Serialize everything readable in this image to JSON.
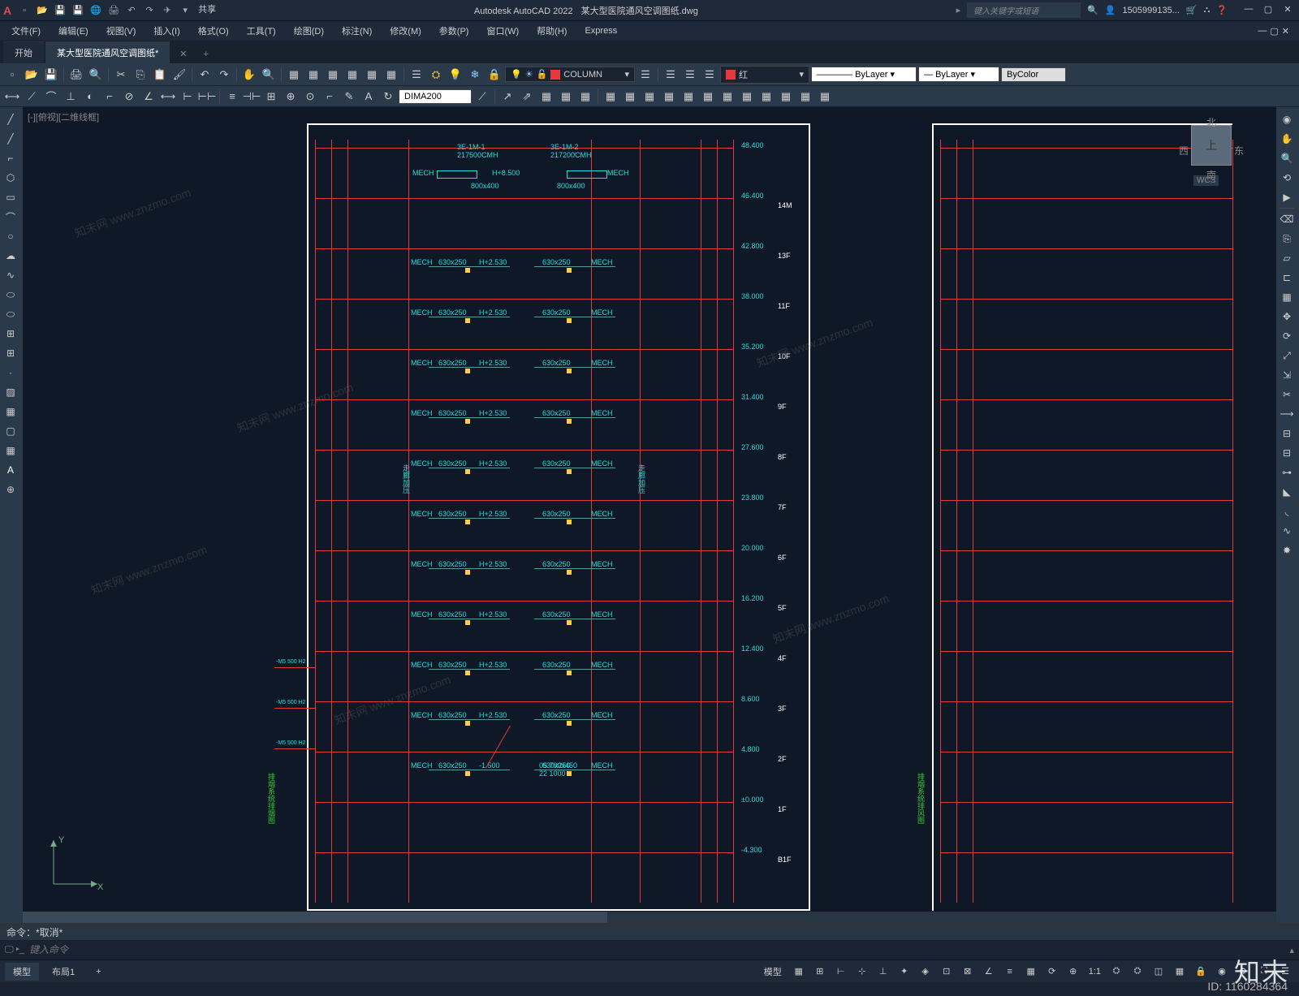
{
  "app": {
    "name": "Autodesk AutoCAD 2022",
    "filename": "某大型医院通风空调图纸.dwg",
    "share": "共享"
  },
  "search_placeholder": "键入关键字或短语",
  "user": "1505999135...",
  "menus": [
    "文件(F)",
    "编辑(E)",
    "视图(V)",
    "插入(I)",
    "格式(O)",
    "工具(T)",
    "绘图(D)",
    "标注(N)",
    "修改(M)",
    "参数(P)",
    "窗口(W)",
    "帮助(H)",
    "Express"
  ],
  "tabs": {
    "start": "开始",
    "doc": "某大型医院通风空调图纸*"
  },
  "layer_current": "COLUMN",
  "color_current": "红",
  "linetype": "ByLayer",
  "lineweight": "ByLayer",
  "plotstyle": "ByColor",
  "dim_style": "DIMA200",
  "view_label": "[-][俯视][二维线框]",
  "viewcube": {
    "top": "上",
    "n": "北",
    "s": "南",
    "e": "东",
    "w": "西",
    "wcs": "WCS"
  },
  "ucs": {
    "x": "X",
    "y": "Y"
  },
  "cmd_history": "命令：*取消*",
  "cmd_placeholder": "键入命令",
  "status": {
    "model": "模型",
    "layout1": "布局1",
    "model_btn": "模型",
    "scale": "1:1"
  },
  "watermark": {
    "brand": "知末",
    "id": "ID: 1160284364"
  },
  "drawing": {
    "units": [
      {
        "label1": "3E-1M-1",
        "label2": "217500CMH"
      },
      {
        "label1": "3E-1M-2",
        "label2": "217200CMH"
      }
    ],
    "top_row": {
      "mech": "MECH",
      "size": "800x400",
      "elev": "H+8.500"
    },
    "floors": [
      {
        "elev": "48.400",
        "floor": ""
      },
      {
        "elev": "46.400",
        "floor": "14M"
      },
      {
        "elev": "42.800",
        "floor": "13F"
      },
      {
        "elev": "38.000",
        "floor": "11F"
      },
      {
        "elev": "35.200",
        "floor": "10F"
      },
      {
        "elev": "31.400",
        "floor": "9F"
      },
      {
        "elev": "27.600",
        "floor": "8F"
      },
      {
        "elev": "23.800",
        "floor": "7F"
      },
      {
        "elev": "20.000",
        "floor": "6F"
      },
      {
        "elev": "16.200",
        "floor": "5F"
      },
      {
        "elev": "12.400",
        "floor": "4F"
      },
      {
        "elev": "8.600",
        "floor": "3F"
      },
      {
        "elev": "4.800",
        "floor": "2F"
      },
      {
        "elev": "±0.000",
        "floor": "1F"
      },
      {
        "elev": "-4.300",
        "floor": "B1F"
      }
    ],
    "duct_rows": [
      {
        "left_size": "630x250",
        "left_elev": "H+2.530",
        "right_size": "630x250"
      },
      {
        "left_size": "630x250",
        "left_elev": "H+2.530",
        "right_size": "630x250"
      },
      {
        "left_size": "630x250",
        "left_elev": "H+2.530",
        "right_size": "630x250"
      },
      {
        "left_size": "630x250",
        "left_elev": "H+2.530",
        "right_size": "630x250"
      },
      {
        "left_size": "630x250",
        "left_elev": "H+2.530",
        "right_size": "630x250"
      },
      {
        "left_size": "630x250",
        "left_elev": "H+2.530",
        "right_size": "630x250"
      },
      {
        "left_size": "630x250",
        "left_elev": "H+2.530",
        "right_size": "630x250"
      },
      {
        "left_size": "630x250",
        "left_elev": "H+2.530",
        "right_size": "630x250"
      },
      {
        "left_size": "630x250",
        "left_elev": "H+2.530",
        "right_size": "630x250"
      },
      {
        "left_size": "630x250",
        "left_elev": "H+2.530",
        "right_size": "630x250"
      },
      {
        "left_size": "630x250",
        "left_elev": "-1.500",
        "right_size": "630x250"
      }
    ],
    "mech": "MECH",
    "callout": {
      "l1": "05  700x450",
      "l2": "22    1000"
    },
    "side_text": "走廊加压",
    "riser_text": "排烟系统排烟图"
  }
}
